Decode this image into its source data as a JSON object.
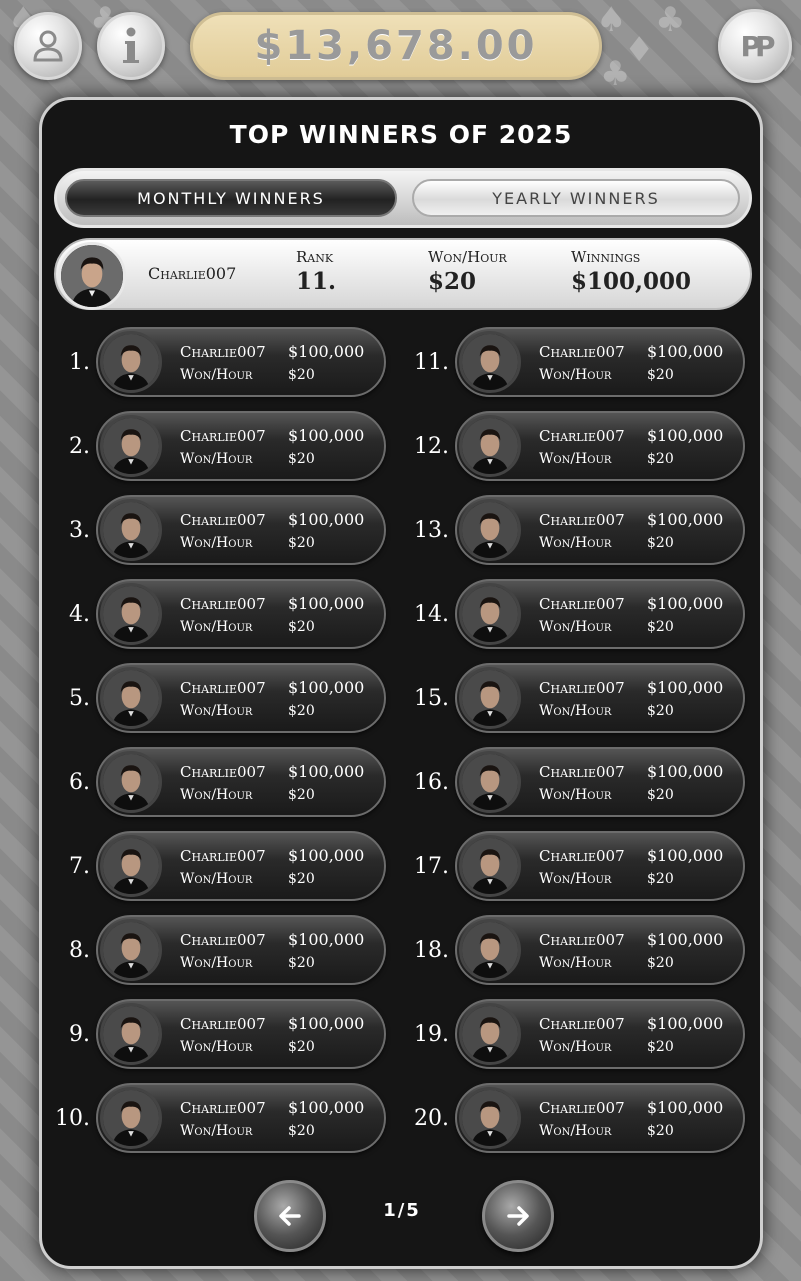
{
  "balance": "$13,678.00",
  "top_buttons": {
    "profile_icon": "person-icon",
    "info_icon": "info-icon",
    "logo_text": "PP"
  },
  "modal": {
    "title": "TOP WINNERS OF 2025",
    "tabs": [
      "MONTHLY WINNERS",
      "YEARLY WINNERS"
    ],
    "active_tab": "MONTHLY WINNERS"
  },
  "me": {
    "name": "Charlie007",
    "rank_label": "Rank",
    "rank": "11.",
    "won_hour_label": "Won/Hour",
    "won_hour": "$20",
    "winnings_label": "Winnings",
    "winnings": "$100,000"
  },
  "list_label_won_hour": "Won/Hour",
  "rows": [
    {
      "rank": "1.",
      "name": "Charlie007",
      "winnings": "$100,000",
      "won_hour": "$20"
    },
    {
      "rank": "2.",
      "name": "Charlie007",
      "winnings": "$100,000",
      "won_hour": "$20"
    },
    {
      "rank": "3.",
      "name": "Charlie007",
      "winnings": "$100,000",
      "won_hour": "$20"
    },
    {
      "rank": "4.",
      "name": "Charlie007",
      "winnings": "$100,000",
      "won_hour": "$20"
    },
    {
      "rank": "5.",
      "name": "Charlie007",
      "winnings": "$100,000",
      "won_hour": "$20"
    },
    {
      "rank": "6.",
      "name": "Charlie007",
      "winnings": "$100,000",
      "won_hour": "$20"
    },
    {
      "rank": "7.",
      "name": "Charlie007",
      "winnings": "$100,000",
      "won_hour": "$20"
    },
    {
      "rank": "8.",
      "name": "Charlie007",
      "winnings": "$100,000",
      "won_hour": "$20"
    },
    {
      "rank": "9.",
      "name": "Charlie007",
      "winnings": "$100,000",
      "won_hour": "$20"
    },
    {
      "rank": "10.",
      "name": "Charlie007",
      "winnings": "$100,000",
      "won_hour": "$20"
    },
    {
      "rank": "11.",
      "name": "Charlie007",
      "winnings": "$100,000",
      "won_hour": "$20"
    },
    {
      "rank": "12.",
      "name": "Charlie007",
      "winnings": "$100,000",
      "won_hour": "$20"
    },
    {
      "rank": "13.",
      "name": "Charlie007",
      "winnings": "$100,000",
      "won_hour": "$20"
    },
    {
      "rank": "14.",
      "name": "Charlie007",
      "winnings": "$100,000",
      "won_hour": "$20"
    },
    {
      "rank": "15.",
      "name": "Charlie007",
      "winnings": "$100,000",
      "won_hour": "$20"
    },
    {
      "rank": "16.",
      "name": "Charlie007",
      "winnings": "$100,000",
      "won_hour": "$20"
    },
    {
      "rank": "17.",
      "name": "Charlie007",
      "winnings": "$100,000",
      "won_hour": "$20"
    },
    {
      "rank": "18.",
      "name": "Charlie007",
      "winnings": "$100,000",
      "won_hour": "$20"
    },
    {
      "rank": "19.",
      "name": "Charlie007",
      "winnings": "$100,000",
      "won_hour": "$20"
    },
    {
      "rank": "20.",
      "name": "Charlie007",
      "winnings": "$100,000",
      "won_hour": "$20"
    }
  ],
  "pagination": {
    "page": "1/5",
    "prev_icon": "arrow-left-icon",
    "next_icon": "arrow-right-icon"
  }
}
